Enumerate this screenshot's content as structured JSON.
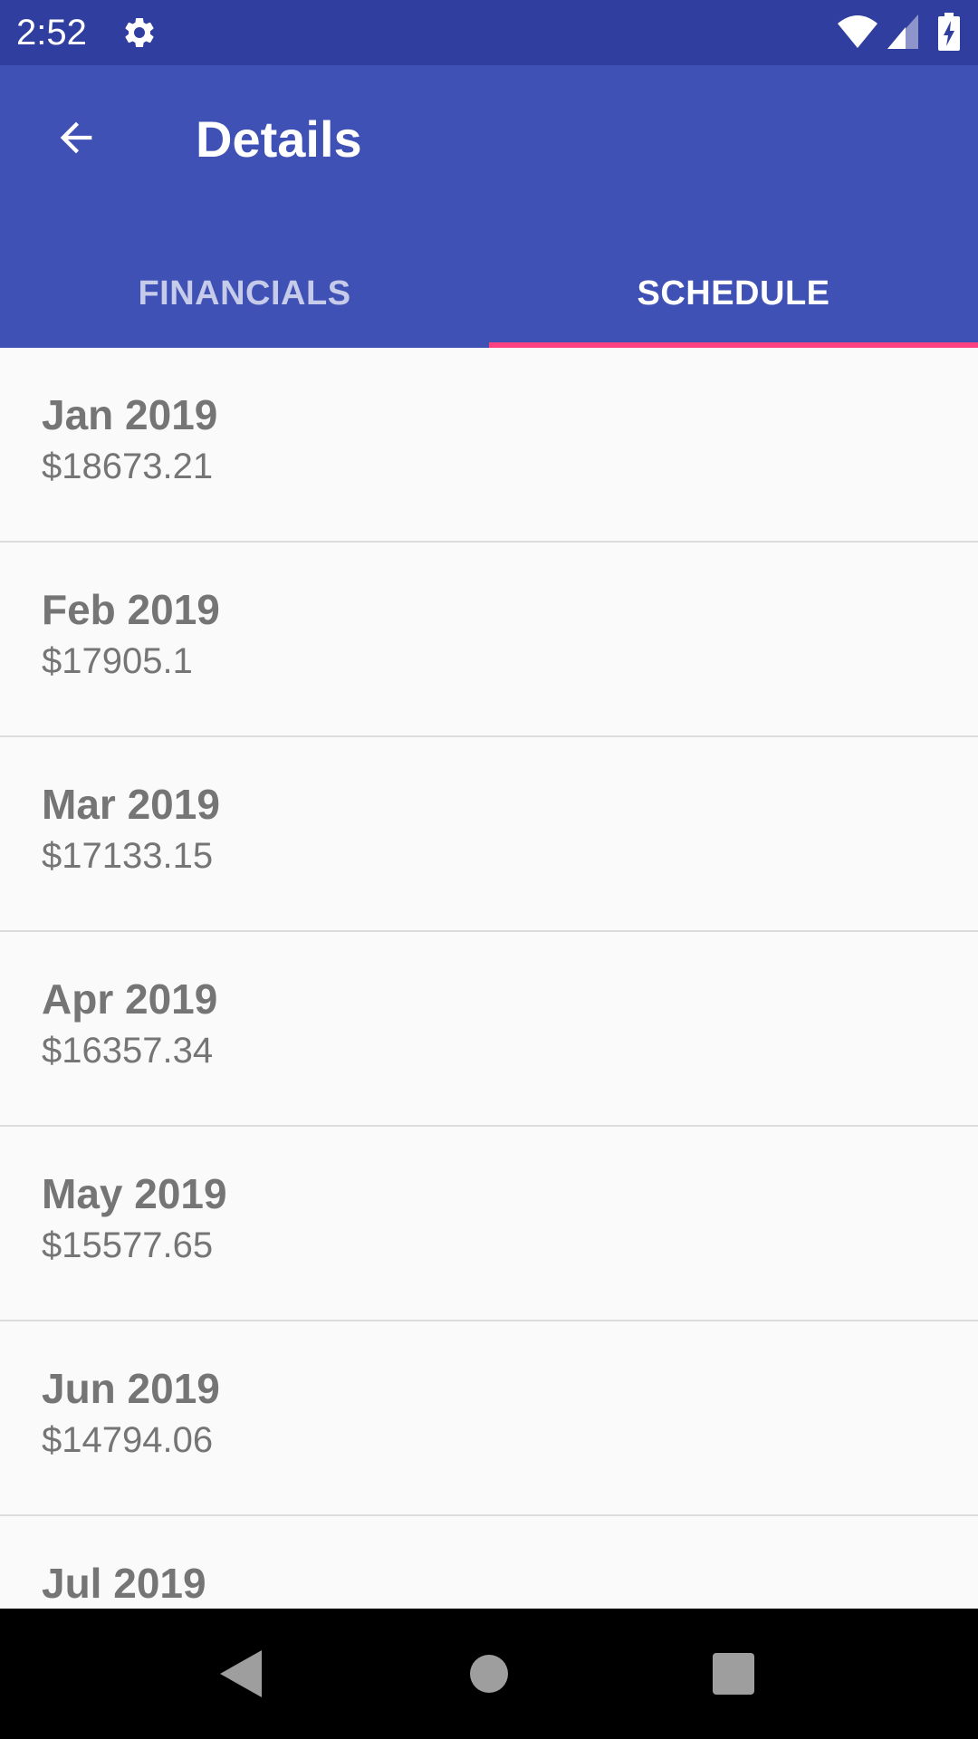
{
  "status_bar": {
    "time": "2:52",
    "icons": [
      "settings-icon",
      "wifi-icon",
      "signal-icon",
      "battery-charging-icon"
    ]
  },
  "app_bar": {
    "back_icon": "arrow-back-icon",
    "title": "Details",
    "color": "#3f51b5",
    "status_color": "#303f9f"
  },
  "tabs": [
    {
      "label": "FINANCIALS",
      "selected": false
    },
    {
      "label": "SCHEDULE",
      "selected": true
    }
  ],
  "accent_color": "#ff4081",
  "schedule": [
    {
      "month": "Jan 2019",
      "amount": "$18673.21"
    },
    {
      "month": "Feb 2019",
      "amount": "$17905.1"
    },
    {
      "month": "Mar 2019",
      "amount": "$17133.15"
    },
    {
      "month": "Apr 2019",
      "amount": "$16357.34"
    },
    {
      "month": "May 2019",
      "amount": "$15577.65"
    },
    {
      "month": "Jun 2019",
      "amount": "$14794.06"
    },
    {
      "month": "Jul 2019",
      "amount": ""
    }
  ],
  "nav_bar": {
    "icons": [
      "nav-back-icon",
      "nav-home-icon",
      "nav-recents-icon"
    ]
  }
}
